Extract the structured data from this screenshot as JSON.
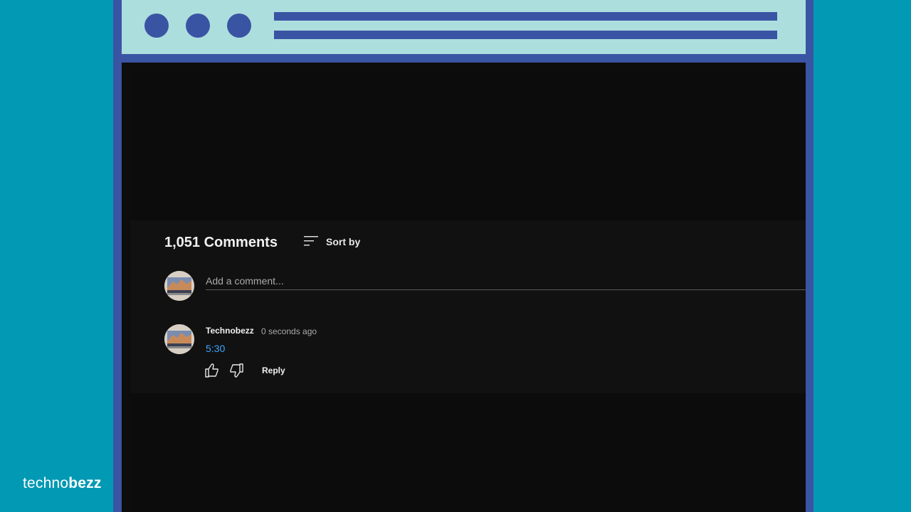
{
  "colors": {
    "background": "#0199b4",
    "frame": "#3a54a4",
    "titlebar": "#addede",
    "screen": "#0d0d0d",
    "panel": "#111111",
    "link": "#3ea6ff"
  },
  "window": {
    "dots": [
      "dot",
      "dot",
      "dot"
    ],
    "titlebar_lines": 2
  },
  "comments": {
    "count_label": "1,051 Comments",
    "sort_icon": "sort-icon",
    "sort_label": "Sort by",
    "input_placeholder": "Add a comment...",
    "input_value": "",
    "items": [
      {
        "author": "Technobezz",
        "time": "0 seconds ago",
        "text": "5:30",
        "like_icon": "thumbs-up-icon",
        "dislike_icon": "thumbs-down-icon",
        "reply_label": "Reply"
      }
    ]
  },
  "brand": {
    "part1": "techno",
    "part2": "bezz"
  }
}
